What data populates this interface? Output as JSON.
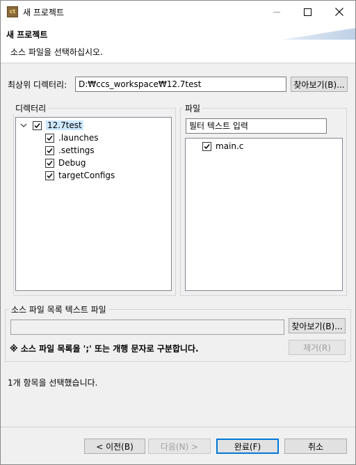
{
  "window": {
    "app_icon_text": "ct",
    "title": "새 프로젝트"
  },
  "header": {
    "title": "새 프로젝트",
    "description": "소스 파일을 선택하십시오."
  },
  "root_dir": {
    "label": "최상위 디렉터리:",
    "value": "D:₩ccs_workspace₩12.7test",
    "browse_label": "찾아보기(B)..."
  },
  "directory_panel": {
    "label": "디렉터리",
    "root": "12.7test",
    "children": [
      ".launches",
      ".settings",
      "Debug",
      "targetConfigs"
    ]
  },
  "file_panel": {
    "label": "파일",
    "filter_placeholder": "필터 텍스트 입력",
    "files": [
      "main.c"
    ]
  },
  "source_list_file": {
    "label": "소스 파일 목록 텍스트 파일",
    "value": "",
    "browse_label": "찾아보기(B)...",
    "note": "※ 소스 파일 목록을 ';' 또는 개행 문자로 구분합니다.",
    "remove_label": "제거(R)"
  },
  "status": {
    "text": "1개 항목을 선택했습니다."
  },
  "buttons": {
    "back": "< 이전(B)",
    "next": "다음(N) >",
    "finish": "완료(F)",
    "cancel": "취소"
  }
}
